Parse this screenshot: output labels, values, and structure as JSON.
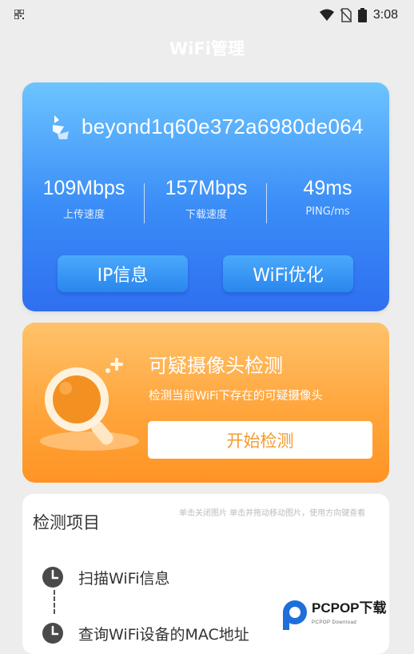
{
  "status_bar": {
    "time": "3:08"
  },
  "title_bar": {
    "title": "WiFi管理"
  },
  "wifi_card": {
    "ssid": "beyond1q60e372a6980de064",
    "stats": [
      {
        "value": "109Mbps",
        "label": "上传速度"
      },
      {
        "value": "157Mbps",
        "label": "下载速度"
      },
      {
        "value": "49ms",
        "label": "PING/ms"
      }
    ],
    "ip_button": "IP信息",
    "optimize_button": "WiFi优化"
  },
  "camera_card": {
    "title": "可疑摄像头检测",
    "subtitle": "检测当前WiFi下存在的可疑摄像头",
    "start_button": "开始检测"
  },
  "list_card": {
    "title": "检测项目",
    "items": [
      {
        "label": "扫描WiFi信息",
        "icon": "clock-icon"
      },
      {
        "label": "查询WiFi设备的MAC地址",
        "icon": "clock-icon"
      }
    ]
  },
  "watermark": {
    "text": "单击关闭图片 单击并拖动移动图片，使用方向键查看",
    "brand": "PCPOP下载",
    "brand_sub": "PCPOP Download"
  },
  "colors": {
    "wifi_card_top": "#6cc4ff",
    "wifi_card_bottom": "#2f6ff0",
    "camera_card_top": "#ffc26a",
    "camera_card_bottom": "#ff9424",
    "accent_orange_text": "#f29b2e",
    "page_bg": "#ededed"
  }
}
